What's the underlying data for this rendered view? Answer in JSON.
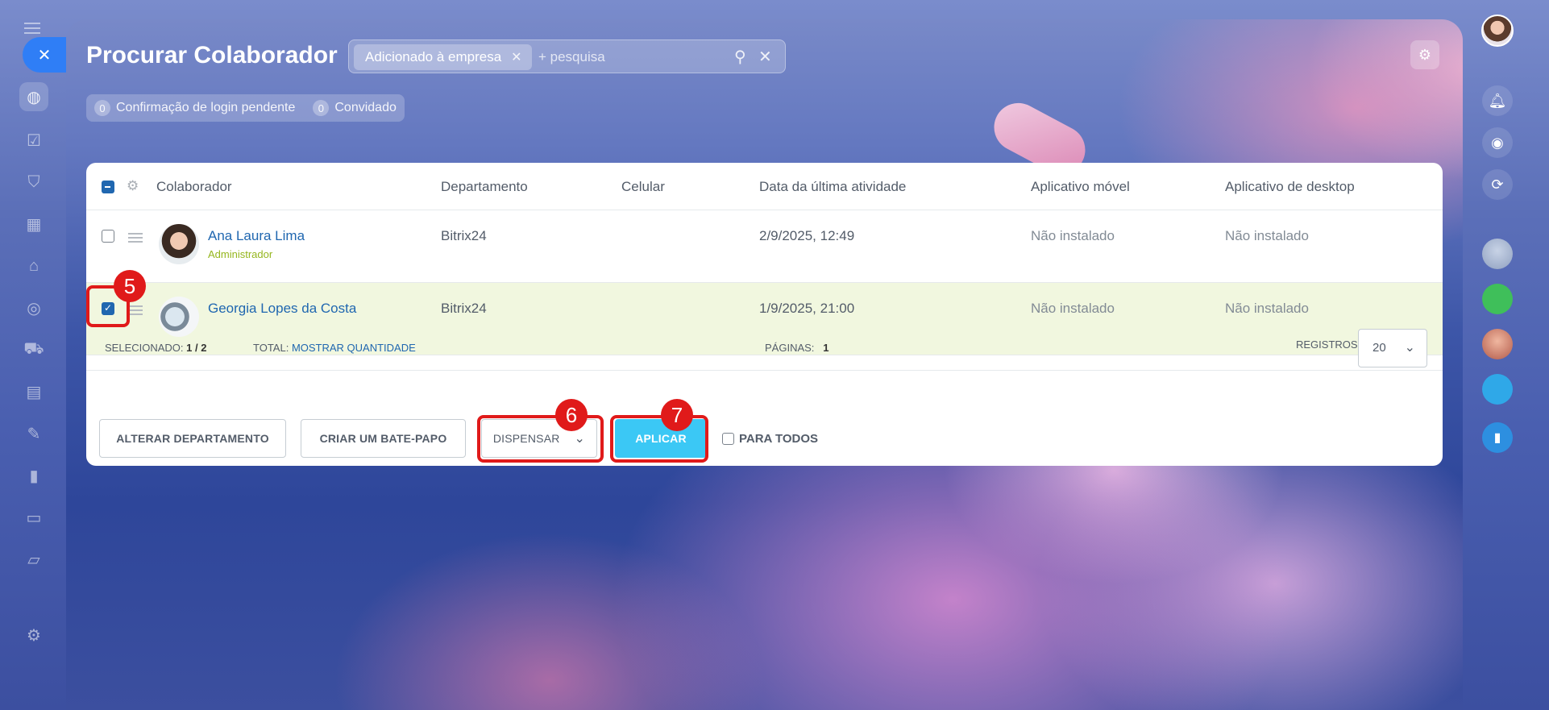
{
  "page": {
    "title": "Procurar Colaborador",
    "settings_icon": "gear-icon"
  },
  "search": {
    "filter_chip": "Adicionado à empresa",
    "placeholder": "+ pesquisa",
    "value": ""
  },
  "counters": [
    {
      "count": "0",
      "label": "Confirmação de login pendente"
    },
    {
      "count": "0",
      "label": "Convidado"
    }
  ],
  "grid": {
    "columns": [
      "Colaborador",
      "Departamento",
      "Celular",
      "Data da última atividade",
      "Aplicativo móvel",
      "Aplicativo de desktop"
    ],
    "rows": [
      {
        "name": "Ana Laura Lima",
        "role": "Administrador",
        "department": "Bitrix24",
        "phone": "",
        "last_activity": "2/9/2025, 12:49",
        "mobile_app": "Não instalado",
        "desktop_app": "Não instalado",
        "selected": false
      },
      {
        "name": "Georgia Lopes da Costa",
        "role": "",
        "department": "Bitrix24",
        "phone": "",
        "last_activity": "1/9/2025, 21:00",
        "mobile_app": "Não instalado",
        "desktop_app": "Não instalado",
        "selected": true
      }
    ],
    "footer": {
      "selected_label": "SELECIONADO:",
      "selected_value": "1 / 2",
      "total_label": "TOTAL:",
      "total_link": "MOSTRAR QUANTIDADE",
      "pages_label": "PÁGINAS:",
      "pages_value": "1",
      "records_label": "REGISTROS:",
      "records_value": "20"
    },
    "actions": {
      "change_department": "ALTERAR DEPARTAMENTO",
      "create_chat": "CRIAR UM BATE-PAPO",
      "action_select": "DISPENSAR",
      "apply": "APLICAR",
      "for_all": "PARA TODOS"
    }
  },
  "annotations": [
    "5",
    "6",
    "7"
  ],
  "colors": {
    "accent_blue": "#2067b0",
    "apply_button": "#3bc8f5",
    "selected_row": "#f1f7df",
    "annotation_red": "#e01a1a",
    "role_green": "#95b61e"
  }
}
